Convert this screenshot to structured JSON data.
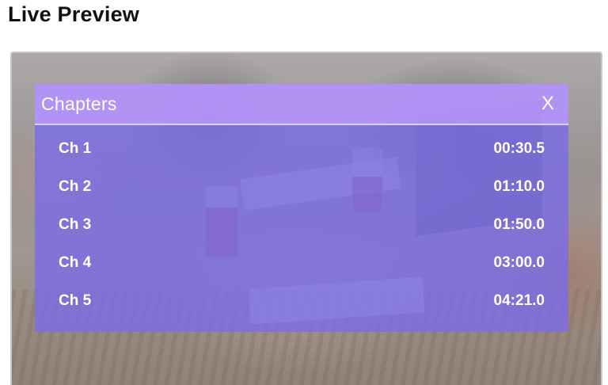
{
  "page": {
    "title": "Live Preview"
  },
  "chapters_panel": {
    "title": "Chapters",
    "close_label": "X",
    "items": [
      {
        "label": "Ch 1",
        "time": "00:30.5"
      },
      {
        "label": "Ch 2",
        "time": "01:10.0"
      },
      {
        "label": "Ch 3",
        "time": "01:50.0"
      },
      {
        "label": "Ch 4",
        "time": "03:00.0"
      },
      {
        "label": "Ch 5",
        "time": "04:21.0"
      }
    ]
  },
  "colors": {
    "panel_overlay": "#7a6ce8",
    "header_overlay": "#c4a0ff",
    "text": "#ffffff",
    "player_border": "#c7c7c7"
  }
}
